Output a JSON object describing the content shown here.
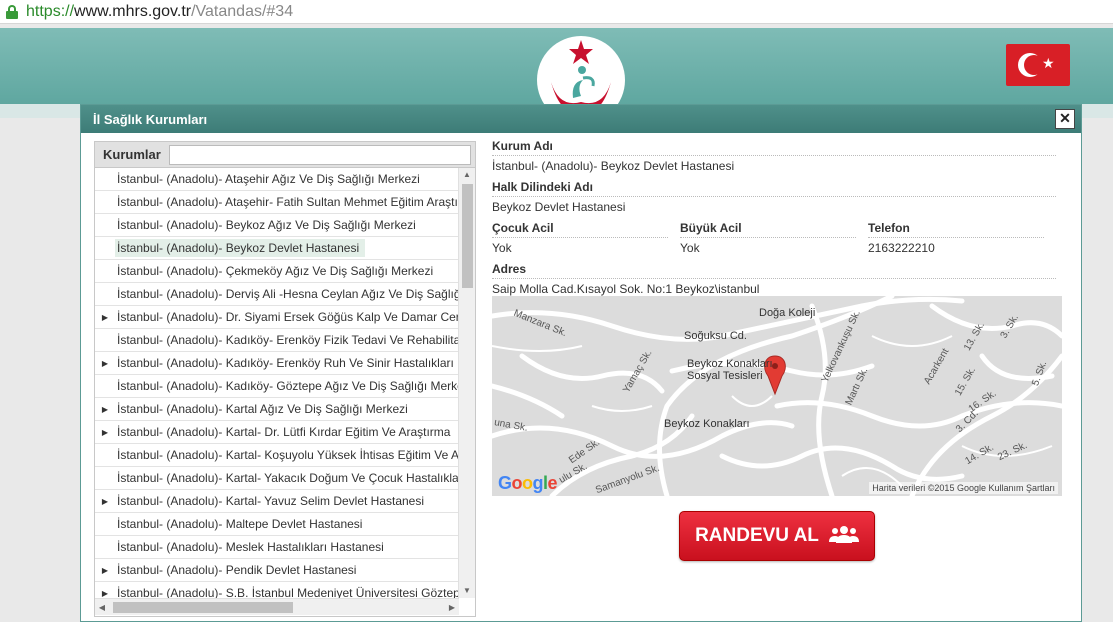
{
  "browser": {
    "url_scheme": "https://",
    "url_host": "www.mhrs.gov.tr",
    "url_path": "/Vatandas/#34"
  },
  "modal": {
    "title": "İl Sağlık Kurumları",
    "close_label": "✕"
  },
  "tree": {
    "header_label": "Kurumlar",
    "search_value": "",
    "items": [
      {
        "label": "İstanbul- (Anadolu)- Ataşehir Ağız Ve Diş Sağlığı Merkezi",
        "expandable": false,
        "selected": false
      },
      {
        "label": "İstanbul- (Anadolu)- Ataşehir- Fatih Sultan Mehmet Eğitim Araştırma",
        "expandable": false,
        "selected": false
      },
      {
        "label": "İstanbul- (Anadolu)- Beykoz Ağız Ve Diş Sağlığı Merkezi",
        "expandable": false,
        "selected": false
      },
      {
        "label": "İstanbul- (Anadolu)- Beykoz Devlet Hastanesi",
        "expandable": false,
        "selected": true
      },
      {
        "label": "İstanbul- (Anadolu)- Çekmeköy Ağız Ve Diş Sağlığı Merkezi",
        "expandable": false,
        "selected": false
      },
      {
        "label": "İstanbul- (Anadolu)- Derviş Ali -Hesna Ceylan Ağız Ve Diş Sağlığı",
        "expandable": false,
        "selected": false
      },
      {
        "label": "İstanbul- (Anadolu)- Dr. Siyami Ersek Göğüs Kalp Ve Damar Cerrahisi",
        "expandable": true,
        "selected": false
      },
      {
        "label": "İstanbul- (Anadolu)- Kadıköy- Erenköy Fizik Tedavi Ve Rehabilitasyon",
        "expandable": false,
        "selected": false
      },
      {
        "label": "İstanbul- (Anadolu)- Kadıköy- Erenköy Ruh Ve Sinir Hastalıkları",
        "expandable": true,
        "selected": false
      },
      {
        "label": "İstanbul- (Anadolu)- Kadıköy- Göztepe Ağız Ve Diş Sağlığı Merkezi",
        "expandable": false,
        "selected": false
      },
      {
        "label": "İstanbul- (Anadolu)- Kartal Ağız Ve Diş Sağlığı Merkezi",
        "expandable": true,
        "selected": false
      },
      {
        "label": "İstanbul- (Anadolu)- Kartal- Dr. Lütfi Kırdar Eğitim Ve Araştırma",
        "expandable": true,
        "selected": false
      },
      {
        "label": "İstanbul- (Anadolu)- Kartal- Koşuyolu Yüksek İhtisas Eğitim Ve Araştırma",
        "expandable": false,
        "selected": false
      },
      {
        "label": "İstanbul- (Anadolu)- Kartal- Yakacık Doğum Ve Çocuk Hastalıkları",
        "expandable": false,
        "selected": false
      },
      {
        "label": "İstanbul- (Anadolu)- Kartal- Yavuz Selim Devlet Hastanesi",
        "expandable": true,
        "selected": false
      },
      {
        "label": "İstanbul- (Anadolu)- Maltepe Devlet Hastanesi",
        "expandable": false,
        "selected": false
      },
      {
        "label": "İstanbul- (Anadolu)- Meslek Hastalıkları Hastanesi",
        "expandable": false,
        "selected": false
      },
      {
        "label": "İstanbul- (Anadolu)- Pendik Devlet Hastanesi",
        "expandable": true,
        "selected": false
      },
      {
        "label": "İstanbul- (Anadolu)- S.B. İstanbul Medeniyet Üniversitesi Göztepe",
        "expandable": true,
        "selected": false
      }
    ]
  },
  "details": {
    "kurum_adi_label": "Kurum Adı",
    "kurum_adi_value": "İstanbul- (Anadolu)- Beykoz Devlet Hastanesi",
    "halk_label": "Halk Dilindeki Adı",
    "halk_value": "Beykoz Devlet Hastanesi",
    "cocuk_acil_label": "Çocuk Acil",
    "cocuk_acil_value": "Yok",
    "buyuk_acil_label": "Büyük Acil",
    "buyuk_acil_value": "Yok",
    "telefon_label": "Telefon",
    "telefon_value": "2163222210",
    "adres_label": "Adres",
    "adres_value": "Saip Molla Cad.Kısayol Sok. No:1 Beykoz\\istanbul"
  },
  "map": {
    "labels": {
      "soguksu": "Soğuksu Cd.",
      "doga": "Doğa Koleji",
      "manzara": "Manzara Sk.",
      "konaklari_sosyal_1": "Beykoz Konakları",
      "konaklari_sosyal_2": "Sosyal Tesisleri",
      "konaklari": "Beykoz Konakları",
      "yamac": "Yamaç Sk.",
      "yelkovan": "Yelkovankuşu Sk.",
      "marti": "Martı Sk.",
      "acarkent": "Acarkent",
      "sk15": "15. Sk.",
      "sk13": "13. Sk.",
      "sk3": "3. Sk.",
      "sk16": "16. Sk.",
      "cd3": "3. Cd.",
      "sk14": "14. Sk.",
      "sk23": "23. Sk.",
      "sk5": "5. Sk.",
      "una": "una Sk.",
      "ede": "Ede Sk.",
      "ulu": "ulu Sk.",
      "samanyolu": "Samanyolu Sk."
    },
    "google_logo": "Google",
    "attribution": "Harita verileri ©2015 Google    Kullanım Şartları"
  },
  "randevu_label": "RANDEVU AL",
  "colors": {
    "header_teal": "#6fb2ac",
    "modal_title": "#46857f",
    "button_red": "#dc1f2e",
    "selected_row": "#e3efe8"
  }
}
